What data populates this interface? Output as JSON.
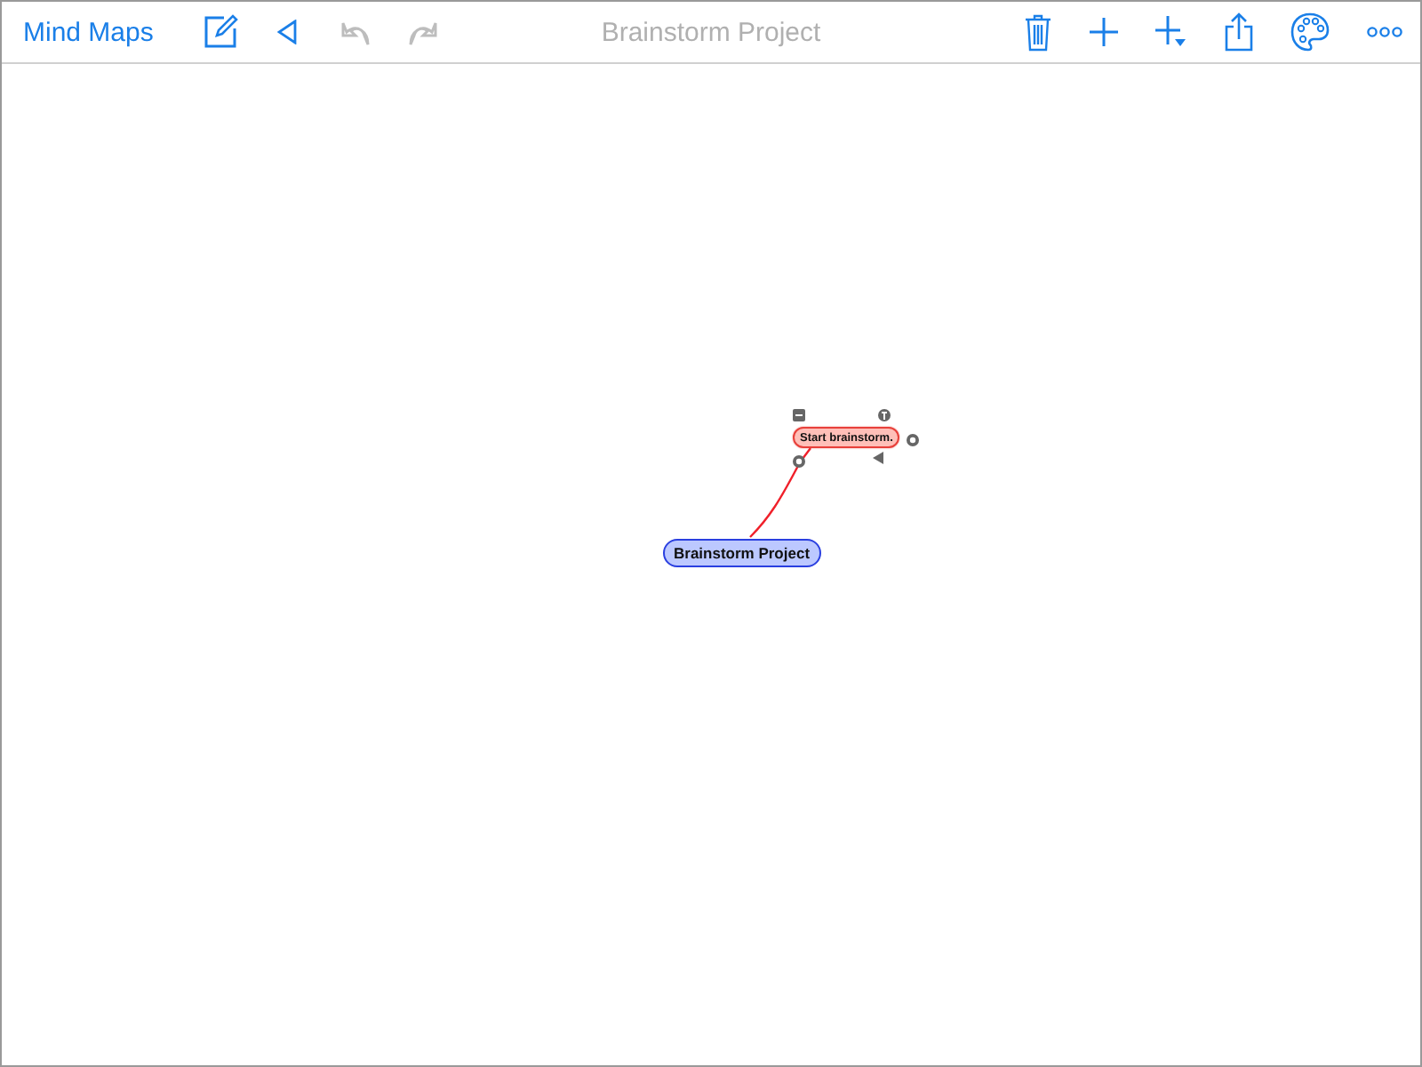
{
  "toolbar": {
    "back_label": "Mind Maps",
    "left_tools": [
      {
        "kind": "edit",
        "disabled": false
      },
      {
        "kind": "back",
        "disabled": false
      },
      {
        "kind": "undo",
        "disabled": true
      },
      {
        "kind": "redo",
        "disabled": true
      }
    ],
    "title": "Brainstorm Project",
    "right_tools": [
      {
        "kind": "trash",
        "disabled": false
      },
      {
        "kind": "add",
        "disabled": false
      },
      {
        "kind": "add-child",
        "disabled": false
      },
      {
        "kind": "share",
        "disabled": false
      },
      {
        "kind": "palette",
        "disabled": false
      },
      {
        "kind": "more",
        "disabled": false
      }
    ]
  },
  "map": {
    "nodes": [
      {
        "kind": "root",
        "text": "Brainstorm Project",
        "color": "#bcc8ff",
        "selected": false
      },
      {
        "kind": "child",
        "text": "Start brainstorm.",
        "color": "#ffbfb8",
        "selected": true
      }
    ]
  }
}
